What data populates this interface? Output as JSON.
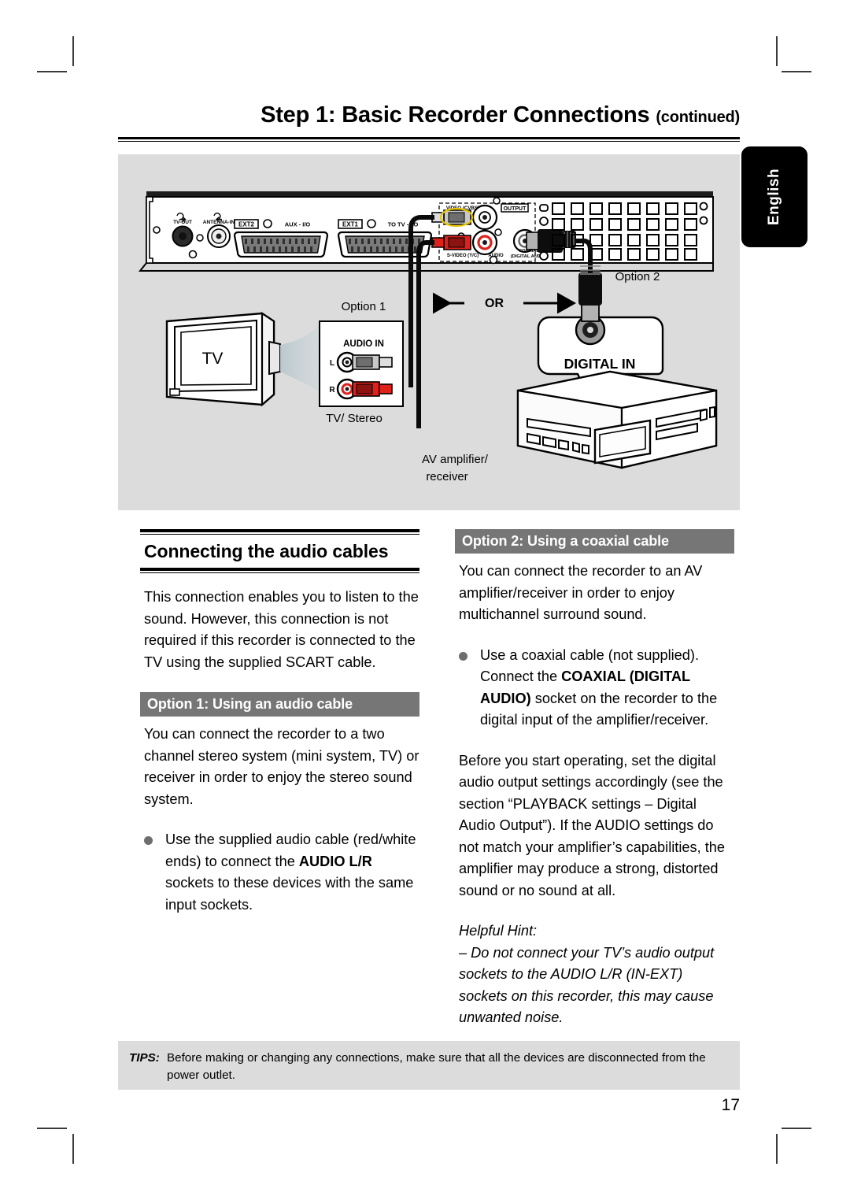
{
  "header": {
    "title_main": "Step 1: Basic Recorder Connections",
    "title_suffix": "(continued)"
  },
  "language_tab": {
    "label": "English"
  },
  "diagram": {
    "rear_panel": {
      "tv_out": "TV-OUT",
      "antenna_in": "ANTENNA-IN",
      "ext2": "EXT2",
      "aux_io": "AUX - I/O",
      "ext1": "EXT1",
      "to_tv_io": "TO TV - I/O",
      "video_cvbs": "VIDEO (CVBS)",
      "output": "OUTPUT",
      "s_video": "S-VIDEO (Y/C)",
      "audio": "AUDIO",
      "coaxial_line1": "COAXIAL",
      "coaxial_line2": "(DIGITAL AUDIO)"
    },
    "option1_label": "Option 1",
    "option2_label": "Option 2",
    "or_label": "OR",
    "tv_label": "TV",
    "tv_stereo_label": "TV/ Stereo",
    "audio_in_label": "AUDIO IN",
    "audio_in_left": "L",
    "audio_in_right": "R",
    "digital_in_label": "DIGITAL IN",
    "amplifier_line1": "AV amplifier/",
    "amplifier_line2": "receiver"
  },
  "left_column": {
    "section_title": "Connecting the audio cables",
    "intro": "This connection enables you to listen to the sound. However, this connection is not required if this recorder is connected to the TV using the supplied SCART cable.",
    "option1_bar": "Option 1: Using an audio cable",
    "option1_para": "You can connect the recorder to a two channel stereo system (mini system, TV) or receiver in order to enjoy the stereo sound system.",
    "bullet1_pre": "Use the supplied audio cable (red/white ends) to connect the ",
    "bullet1_bold": "AUDIO L/R",
    "bullet1_post": " sockets to these devices with the same input sockets."
  },
  "right_column": {
    "option2_bar": "Option 2: Using a coaxial cable",
    "option2_para": "You can connect the recorder to an AV amplifier/receiver in order to enjoy multichannel surround sound.",
    "bullet1_pre": "Use a coaxial cable (not supplied). Connect the ",
    "bullet1_bold": "COAXIAL (DIGITAL AUDIO)",
    "bullet1_post": " socket on the recorder to the digital input of the amplifier/receiver.",
    "settings_para": "Before you start operating, set the digital audio output settings accordingly (see the section “PLAYBACK settings – Digital Audio Output”). If the AUDIO settings do not match your amplifier’s capabilities, the amplifier may produce a strong, distorted sound or no sound at all.",
    "hint_title": "Helpful Hint:",
    "hint_body": "– Do not connect your TV’s audio output sockets to the AUDIO L/R (IN-EXT) sockets on this recorder, this may cause unwanted noise."
  },
  "footer": {
    "tips_label": "TIPS:",
    "tips_text": "Before making or changing any connections, make sure that all the devices are disconnected from the power outlet.",
    "page_number": "17"
  },
  "colors": {
    "panel_bg": "#dcdcdc",
    "option_bar": "#767676",
    "accent_red": "#e0201b",
    "black": "#000000"
  }
}
